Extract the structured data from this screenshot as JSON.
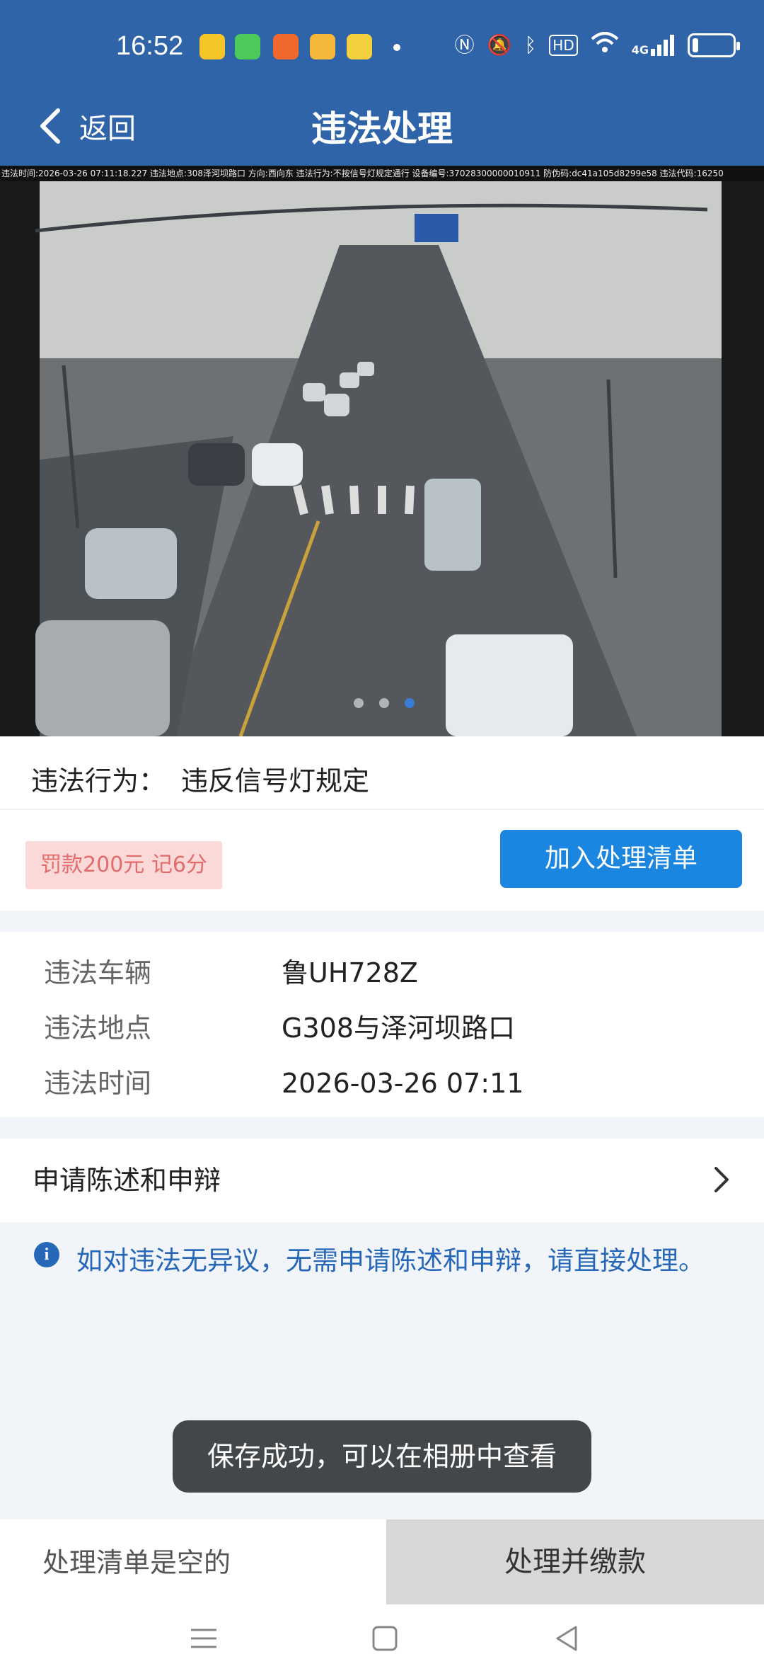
{
  "status_bar": {
    "time": "16:52",
    "icons": [
      "app-icon-1",
      "app-icon-2",
      "app-icon-3",
      "app-icon-4",
      "app-icon-5",
      "nfc-icon",
      "mute-icon",
      "bluetooth-icon",
      "hd-icon",
      "wifi-icon",
      "signal-4g-icon",
      "battery-icon"
    ],
    "hd_label": "HD",
    "network_label": "4G",
    "battery_level": 0.15
  },
  "nav": {
    "back_label": "返回",
    "title": "违法处理"
  },
  "photo": {
    "caption": "违法时间:2026-03-26 07:11:18.227 违法地点:308泽河坝路口 方向:西向东 违法行为:不按信号灯规定通行 设备编号:37028300000010911 防伪码:dc41a105d8299e58 违法代码:16250",
    "page_count": 3,
    "active_page": 3
  },
  "violation": {
    "behavior_label": "违法行为：",
    "behavior_value": "违反信号灯规定",
    "penalty": "罚款200元 记6分",
    "add_button": "加入处理清单"
  },
  "details": {
    "rows": [
      {
        "key": "违法车辆",
        "value": "鲁UH728Z"
      },
      {
        "key": "违法地点",
        "value": "G308与泽河坝路口"
      },
      {
        "key": "违法时间",
        "value": "2026-03-26 07:11"
      }
    ]
  },
  "appeal": {
    "label": "申请陈述和申辩"
  },
  "info": {
    "text": "如对违法无异议，无需申请陈述和申辩，请直接处理。"
  },
  "toast": {
    "text": "保存成功，可以在相册中查看"
  },
  "bottom_bar": {
    "list_status": "处理清单是空的",
    "pay_button": "处理并缴款"
  },
  "colors": {
    "header": "#2f64a8",
    "accent": "#1a86e0",
    "penalty_bg": "#fbd9d9",
    "penalty_text": "#e26b6b",
    "info_text": "#2767b8"
  }
}
